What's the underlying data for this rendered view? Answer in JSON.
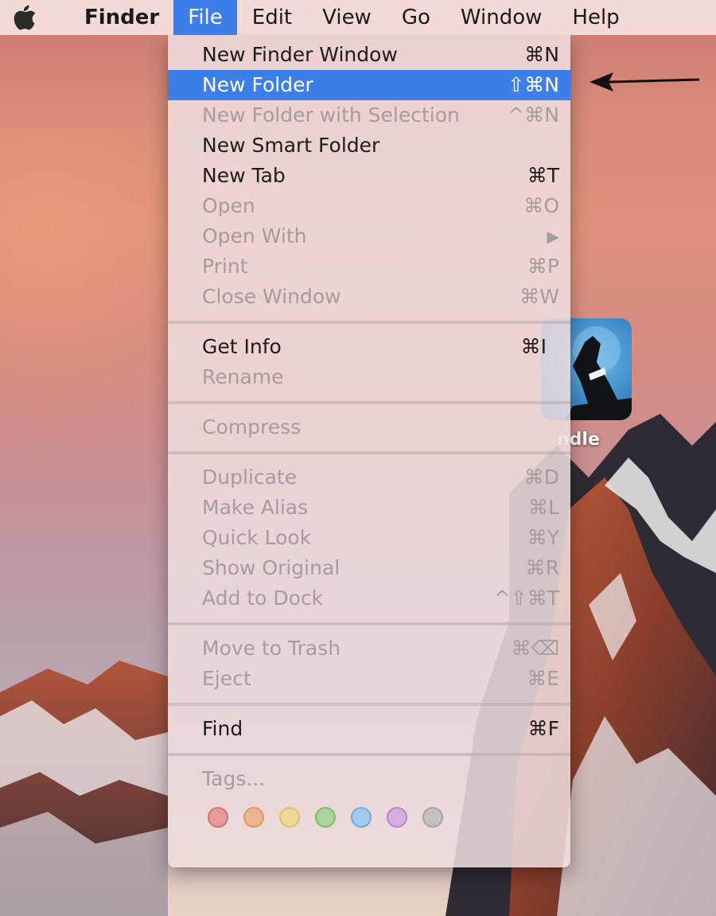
{
  "menubar": {
    "items": [
      "Finder",
      "File",
      "Edit",
      "View",
      "Go",
      "Window",
      "Help"
    ],
    "active_item": "File"
  },
  "file_menu": {
    "groups": [
      [
        {
          "label": "New Finder Window",
          "shortcut": "⌘N",
          "enabled": true
        },
        {
          "label": "New Folder",
          "shortcut": "⇧⌘N",
          "enabled": true,
          "highlighted": true
        },
        {
          "label": "New Folder with Selection",
          "shortcut": "^⌘N",
          "enabled": false
        },
        {
          "label": "New Smart Folder",
          "shortcut": "",
          "enabled": true
        },
        {
          "label": "New Tab",
          "shortcut": "⌘T",
          "enabled": true
        },
        {
          "label": "Open",
          "shortcut": "⌘O",
          "enabled": false
        },
        {
          "label": "Open With",
          "shortcut": "▶",
          "enabled": false
        },
        {
          "label": "Print",
          "shortcut": "⌘P",
          "enabled": false
        },
        {
          "label": "Close Window",
          "shortcut": "⌘W",
          "enabled": false
        }
      ],
      [
        {
          "label": "Get Info",
          "shortcut": "⌘I",
          "enabled": true
        },
        {
          "label": "Rename",
          "shortcut": "",
          "enabled": false
        }
      ],
      [
        {
          "label": "Compress",
          "shortcut": "",
          "enabled": false
        }
      ],
      [
        {
          "label": "Duplicate",
          "shortcut": "⌘D",
          "enabled": false
        },
        {
          "label": "Make Alias",
          "shortcut": "⌘L",
          "enabled": false
        },
        {
          "label": "Quick Look",
          "shortcut": "⌘Y",
          "enabled": false
        },
        {
          "label": "Show Original",
          "shortcut": "⌘R",
          "enabled": false
        },
        {
          "label": "Add to Dock",
          "shortcut": "^⇧⌘T",
          "enabled": false
        }
      ],
      [
        {
          "label": "Move to Trash",
          "shortcut": "⌘⌫",
          "enabled": false
        },
        {
          "label": "Eject",
          "shortcut": "⌘E",
          "enabled": false
        }
      ],
      [
        {
          "label": "Find",
          "shortcut": "⌘F",
          "enabled": true
        }
      ],
      [
        {
          "label": "Tags...",
          "shortcut": "",
          "enabled": false
        }
      ]
    ],
    "tag_colors": [
      {
        "name": "red",
        "fill": "#e8999a",
        "stroke": "#d9706f"
      },
      {
        "name": "orange",
        "fill": "#ebb58f",
        "stroke": "#dc9a66"
      },
      {
        "name": "yellow",
        "fill": "#eed79a",
        "stroke": "#dcc070"
      },
      {
        "name": "green",
        "fill": "#a8d39a",
        "stroke": "#7ebf6c"
      },
      {
        "name": "blue",
        "fill": "#a2c8ec",
        "stroke": "#72aadf"
      },
      {
        "name": "purple",
        "fill": "#d6aee0",
        "stroke": "#bc86ca"
      },
      {
        "name": "gray",
        "fill": "#c4bfc1",
        "stroke": "#a9a3a5"
      }
    ]
  },
  "desktop": {
    "app_icon_label": "ndle",
    "app_icon_name": "kindle-icon"
  },
  "colors": {
    "highlight": "#3d7fe8",
    "enabled_text": "#1d1d1d",
    "disabled_text": "#a69c9e"
  },
  "icons": [
    "apple-logo-icon",
    "kindle-icon",
    "arrow-left-icon"
  ]
}
